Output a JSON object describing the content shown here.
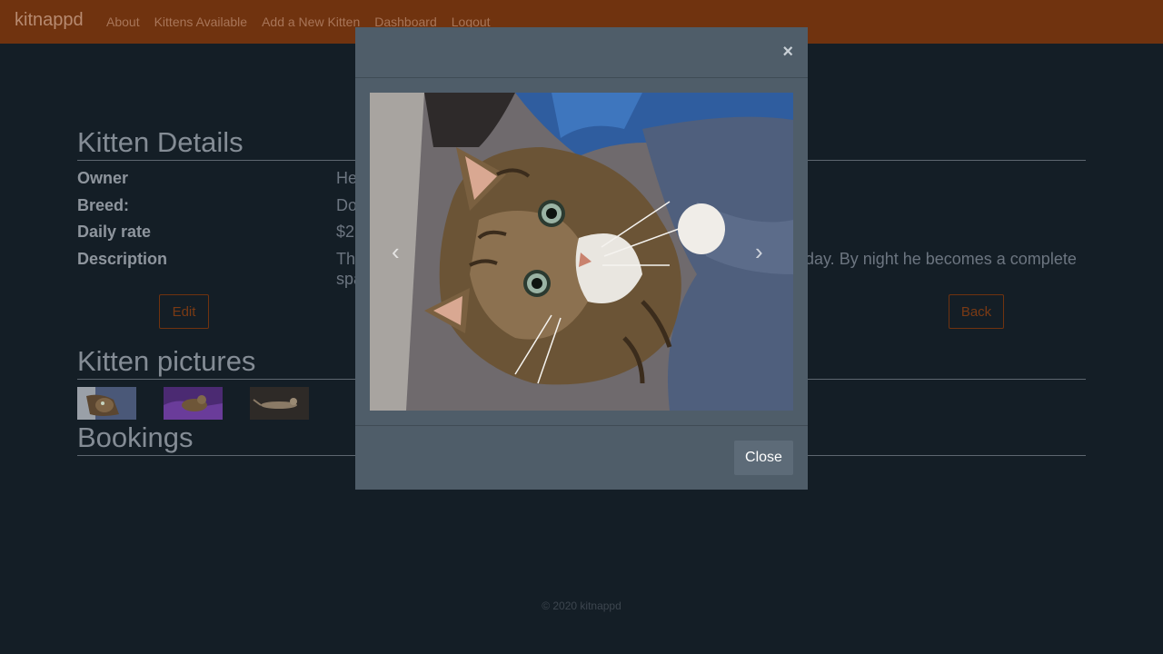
{
  "nav": {
    "brand": "kitnappd",
    "links": [
      "About",
      "Kittens Available",
      "Add a New Kitten",
      "Dashboard",
      "Logout"
    ]
  },
  "details": {
    "title": "Kitten Details",
    "owner_label": "Owner",
    "owner_value": "He",
    "breed_label": "Breed:",
    "breed_value": "Do",
    "rate_label": "Daily rate",
    "rate_value": "$2",
    "description_label": "Description",
    "description_value_start": "Th",
    "description_value_end": "day. By night he becomes a complete",
    "description_value_line2": "spa",
    "edit_label": "Edit",
    "back_label": "Back"
  },
  "pictures": {
    "title": "Kitten pictures"
  },
  "bookings": {
    "title": "Bookings"
  },
  "footer": {
    "text": "© 2020 kitnappd"
  },
  "modal": {
    "close_x": "×",
    "close_label": "Close",
    "prev_icon": "‹",
    "next_icon": "›"
  },
  "colors": {
    "navbar": "#70330f",
    "background": "#141e26",
    "modal": "#4f5d69"
  }
}
